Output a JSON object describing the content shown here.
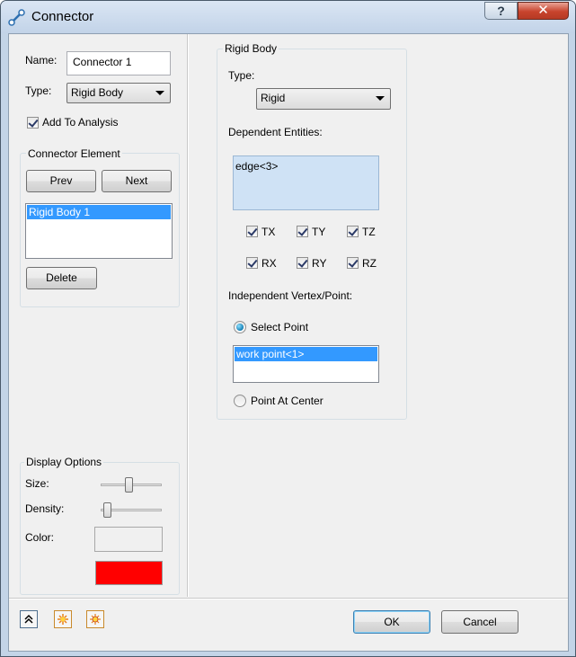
{
  "window": {
    "title": "Connector",
    "help_label": "?",
    "close_label": "✕"
  },
  "left": {
    "name_label": "Name:",
    "name_value": "Connector 1",
    "type_label": "Type:",
    "type_value": "Rigid Body",
    "add_to_analysis_label": "Add To Analysis",
    "add_to_analysis_checked": true,
    "connector_element": {
      "title": "Connector Element",
      "prev_label": "Prev",
      "next_label": "Next",
      "items": [
        "Rigid Body 1"
      ],
      "delete_label": "Delete"
    },
    "display_options": {
      "title": "Display Options",
      "size_label": "Size:",
      "size_level": 0.45,
      "density_label": "Density:",
      "density_level": 0.05,
      "color_label": "Color:",
      "color_top": "#f0f0f0",
      "color_bottom": "#ff0000"
    }
  },
  "right": {
    "group_title": "Rigid Body",
    "type_label": "Type:",
    "type_value": "Rigid",
    "dependent_label": "Dependent Entities:",
    "dependent_items": [
      "edge<3>"
    ],
    "dofs": [
      {
        "label": "TX",
        "checked": true
      },
      {
        "label": "TY",
        "checked": true
      },
      {
        "label": "TZ",
        "checked": true
      },
      {
        "label": "RX",
        "checked": true
      },
      {
        "label": "RY",
        "checked": true
      },
      {
        "label": "RZ",
        "checked": true
      }
    ],
    "independent_label": "Independent Vertex/Point:",
    "select_point_label": "Select Point",
    "independent_items": [
      "work point<1>"
    ],
    "point_center_label": "Point At Center"
  },
  "footer": {
    "icons": [
      "expand-up-icon",
      "highlight-icon",
      "highlight-all-icon"
    ],
    "ok_label": "OK",
    "cancel_label": "Cancel"
  }
}
